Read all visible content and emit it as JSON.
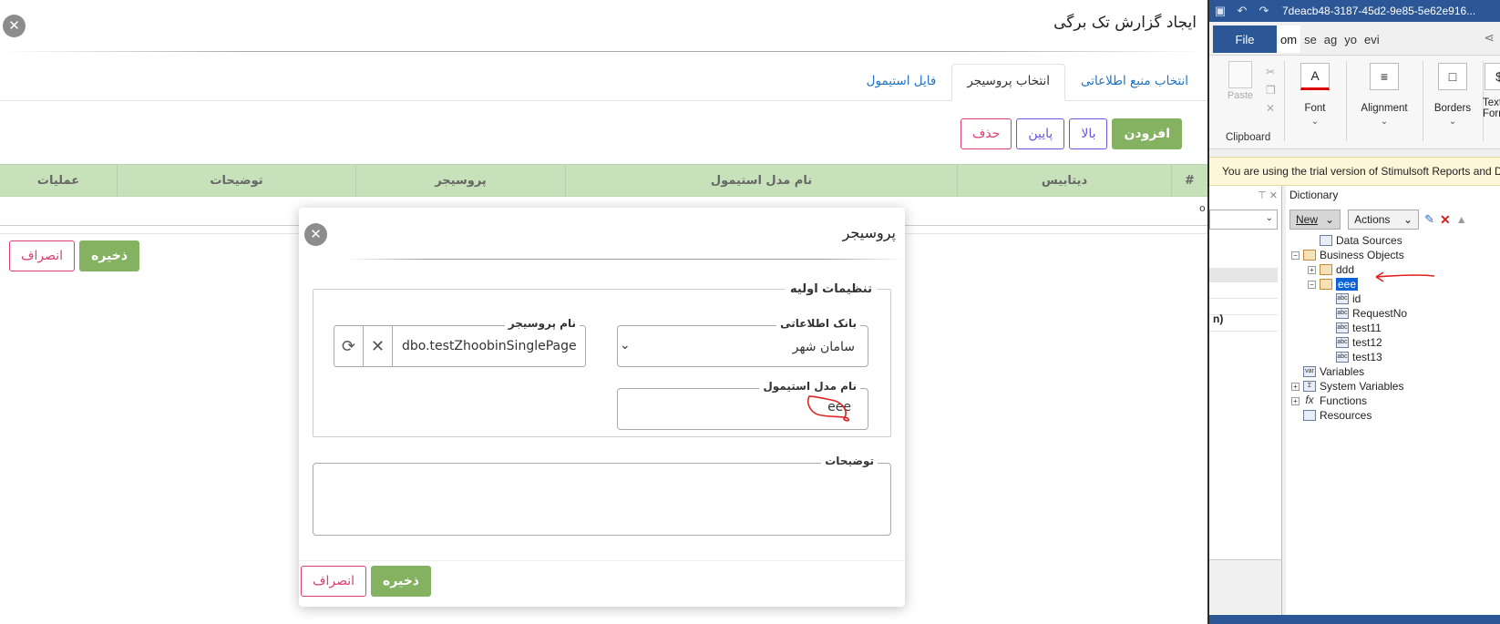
{
  "page": {
    "title": "ایجاد گزارش تک برگی",
    "tabs": [
      "انتخاب منبع اطلاعاتی",
      "انتخاب پروسیجر",
      "فایل استیمول"
    ],
    "active_tab": 1,
    "toolbar": {
      "add": "افزودن",
      "up": "بالا",
      "down": "پایین",
      "delete": "حذف"
    },
    "table": {
      "headers": [
        "#",
        "دیتابیس",
        "نام مدل استیمول",
        "پروسیجر",
        "توضیحات",
        "عملیات"
      ],
      "empty": "...."
    },
    "actions": {
      "save": "ذخیره",
      "cancel": "انصراف"
    },
    "close_glyph": "✕"
  },
  "modal": {
    "title": "پروسیجر",
    "group_legend": "تنظیمات اولیه",
    "db_label": "بانک اطلاعاتی",
    "db_value": "سامان شهر",
    "proc_label": "نام پروسیجر",
    "proc_value": "dbo.testZhoobinSinglePage",
    "model_label": "نام مدل استیمول",
    "model_value": "eee",
    "desc_label": "توضیحات",
    "save": "ذخیره",
    "cancel": "انصراف",
    "close_glyph": "✕"
  },
  "designer": {
    "window_title": "7deacb48-3187-45d2-9e85-5e62e916...",
    "file_tab": "File",
    "ribbon_tabs": [
      "om",
      "se",
      "ag",
      "yo",
      "evi"
    ],
    "clipboard": {
      "paste": "Paste",
      "label": "Clipboard"
    },
    "groups": [
      {
        "label": "Font",
        "icon": "A"
      },
      {
        "label": "Alignment",
        "icon": "≡"
      },
      {
        "label": "Borders",
        "icon": "□"
      },
      {
        "label": "Text Format",
        "icon": "$"
      }
    ],
    "trial_text": "You are using the trial version of Stimulsoft Reports and Dashboards",
    "left_pane_text": "n)",
    "dictionary": {
      "title": "Dictionary",
      "new_btn": "New",
      "actions_btn": "Actions",
      "tree": [
        {
          "label": "Data Sources",
          "level": 1,
          "icon": "ds",
          "toggle": ""
        },
        {
          "label": "Business Objects",
          "level": 0,
          "icon": "bo",
          "toggle": "−"
        },
        {
          "label": "ddd",
          "level": 1,
          "icon": "bo",
          "toggle": "+"
        },
        {
          "label": "eee",
          "level": 1,
          "icon": "bo",
          "toggle": "−",
          "selected": true
        },
        {
          "label": "id",
          "level": 2,
          "icon": "abc",
          "toggle": ""
        },
        {
          "label": "RequestNo",
          "level": 2,
          "icon": "abc",
          "toggle": ""
        },
        {
          "label": "test11",
          "level": 2,
          "icon": "abc",
          "toggle": ""
        },
        {
          "label": "test12",
          "level": 2,
          "icon": "abc",
          "toggle": ""
        },
        {
          "label": "test13",
          "level": 2,
          "icon": "abc",
          "toggle": ""
        },
        {
          "label": "Variables",
          "level": 0,
          "icon": "var",
          "toggle": ""
        },
        {
          "label": "System Variables",
          "level": 0,
          "icon": "sys",
          "toggle": "+"
        },
        {
          "label": "Functions",
          "level": 0,
          "icon": "fx",
          "toggle": "+"
        },
        {
          "label": "Resources",
          "level": 0,
          "icon": "res",
          "toggle": ""
        }
      ]
    }
  },
  "colors": {
    "green": "#85b260",
    "purple": "#6a55e0",
    "pink": "#e03d72",
    "table_header": "#c7e2bb",
    "stimulsoft_blue": "#2b5797"
  }
}
